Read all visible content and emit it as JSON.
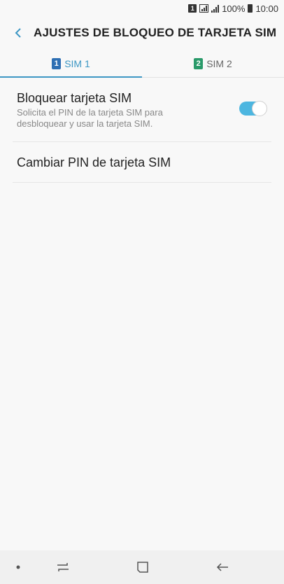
{
  "status_bar": {
    "sim_indicator": "1",
    "battery_text": "100%",
    "time": "10:00",
    "icons": [
      "sim-1-icon",
      "signal-box-icon",
      "signal-bars-icon",
      "battery-icon"
    ]
  },
  "header": {
    "back_icon": "chevron-left-icon",
    "title": "AJUSTES DE BLOQUEO DE TARJETA SIM"
  },
  "tabs": [
    {
      "badge": "1",
      "label": "SIM 1",
      "active": true,
      "badge_color": "#2e6fb3"
    },
    {
      "badge": "2",
      "label": "SIM 2",
      "active": false,
      "badge_color": "#2a9a6a"
    }
  ],
  "settings": {
    "lock_sim": {
      "title": "Bloquear tarjeta SIM",
      "description": "Solicita el PIN de la tarjeta SIM para desbloquear y usar la tarjeta SIM.",
      "toggle_on": true
    },
    "change_pin": {
      "title": "Cambiar PIN de tarjeta SIM"
    }
  },
  "colors": {
    "accent": "#3d97c4",
    "toggle_track": "#4db6e0"
  },
  "navbar": {
    "icons": [
      "dot-icon",
      "recent-apps-icon",
      "home-icon",
      "back-arrow-icon"
    ]
  }
}
